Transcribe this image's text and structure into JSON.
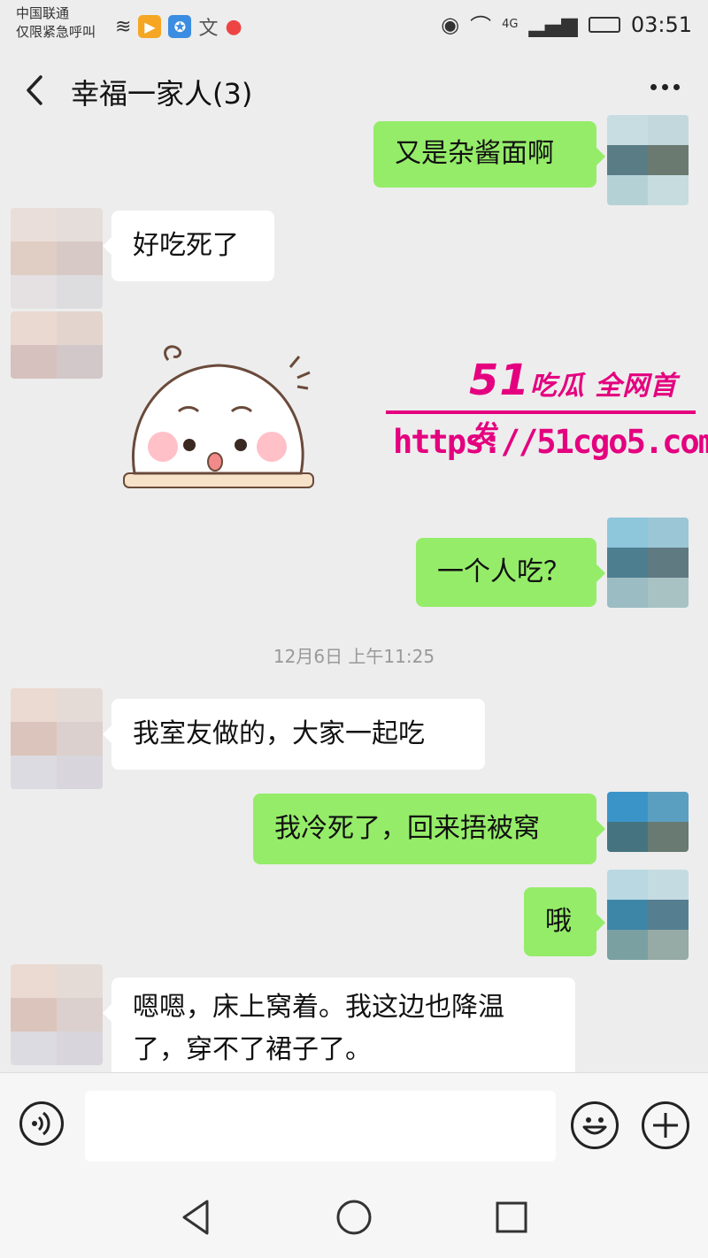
{
  "status_bar": {
    "carrier_line1": "中国联通",
    "carrier_line2": "仅限紧急呼叫",
    "network": "4G",
    "time": "03:51"
  },
  "header": {
    "back_icon": "chevron-left-icon",
    "title": "幸福一家人(3)",
    "more_icon": "more-dots-icon"
  },
  "messages": [
    {
      "side": "out",
      "text": "又是杂酱面啊"
    },
    {
      "side": "in",
      "text": "好吃死了"
    },
    {
      "side": "in",
      "type": "sticker"
    },
    {
      "side": "out",
      "text": "一个人吃？"
    },
    {
      "side": "in",
      "text": "我室友做的，大家一起吃"
    },
    {
      "side": "out",
      "text": "我冷死了，回来捂被窝"
    },
    {
      "side": "out",
      "text": "哦"
    },
    {
      "side": "in",
      "text_line1": "嗯嗯，床上窝着。我这边也降温",
      "text_line2": "了，穿不了裙子了。"
    }
  ],
  "timestamp": "12月6日 上午11:25",
  "watermark": {
    "brand_num": "51",
    "brand_text": "吃瓜 全网首发",
    "url": "https://51cgo5.com"
  },
  "input_bar": {
    "voice_icon": "voice-icon",
    "input_value": "",
    "emoji_icon": "emoji-icon",
    "plus_icon": "plus-icon"
  },
  "nav_bar": {
    "back_icon": "nav-back-icon",
    "home_icon": "nav-home-icon",
    "recents_icon": "nav-recents-icon"
  },
  "colors": {
    "background": "#ededed",
    "outgoing_bubble": "#95ec69",
    "incoming_bubble": "#ffffff",
    "watermark": "#e4007f"
  }
}
